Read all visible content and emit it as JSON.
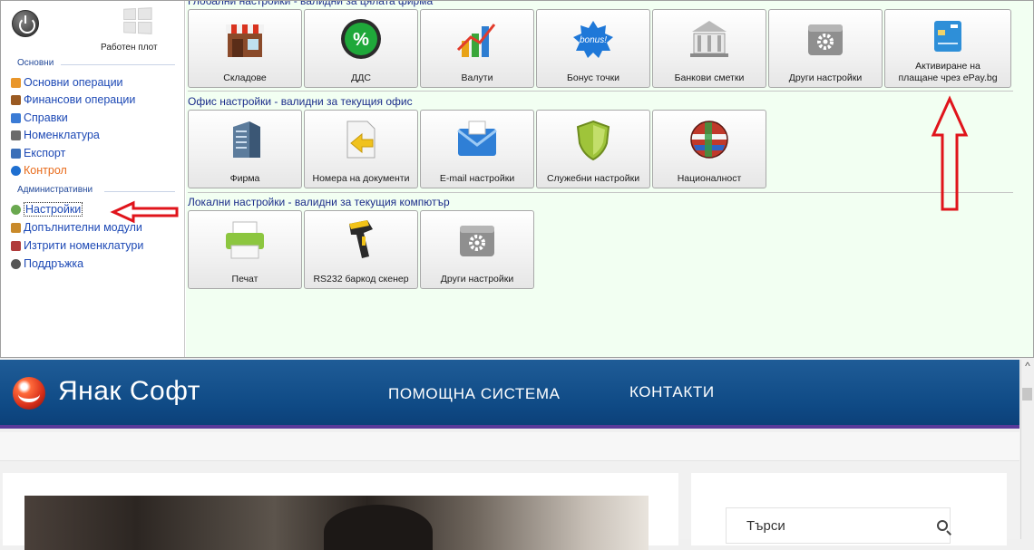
{
  "sidebar": {
    "desktop_label": "Работен плот",
    "groups": {
      "basic_title": "Основни",
      "admin_title": "Административни"
    },
    "basic_items": [
      {
        "label": "Основни операции",
        "icon": "clipboard-icon",
        "color": "#e9962a"
      },
      {
        "label": "Финансови операции",
        "icon": "money-icon",
        "color": "#9a5a22"
      },
      {
        "label": "Справки",
        "icon": "people-report-icon",
        "color": "#3a7bd5"
      },
      {
        "label": "Номенклатура",
        "icon": "person-list-icon",
        "color": "#6b6b6b"
      },
      {
        "label": "Експорт",
        "icon": "export-icon",
        "color": "#3b6fb8"
      },
      {
        "label": "Контрол",
        "icon": "info-icon",
        "color": "#1e6fd0"
      }
    ],
    "admin_items": [
      {
        "label": "Настройки",
        "icon": "settings-icon",
        "color": "#6aa84f"
      },
      {
        "label": "Допълнителни модули",
        "icon": "modules-icon",
        "color": "#c98a2a"
      },
      {
        "label": "Изтрити номенклатури",
        "icon": "deleted-users-icon",
        "color": "#b03a3a"
      },
      {
        "label": "Поддръжка",
        "icon": "support-icon",
        "color": "#555555"
      }
    ]
  },
  "sections": {
    "global_title": "Глобални настройки - валидни за цялата фирма",
    "office_title": "Офис настройки - валидни за текущия офис",
    "local_title": "Локални настройки - валидни за текущия компютър"
  },
  "tiles": {
    "global": [
      {
        "label": "Складове",
        "icon": "store-icon"
      },
      {
        "label": "ДДС",
        "icon": "vat-percent-icon"
      },
      {
        "label": "Валути",
        "icon": "currency-chart-icon"
      },
      {
        "label": "Бонус точки",
        "icon": "bonus-icon"
      },
      {
        "label": "Банкови сметки",
        "icon": "bank-icon"
      },
      {
        "label": "Други настройки",
        "icon": "gear-box-icon"
      },
      {
        "label": "Активиране на плащане чрез ePay.bg",
        "icon": "credit-card-icon"
      }
    ],
    "office": [
      {
        "label": "Фирма",
        "icon": "building-icon"
      },
      {
        "label": "Номера на документи",
        "icon": "document-icon"
      },
      {
        "label": "E-mail настройки",
        "icon": "email-icon"
      },
      {
        "label": "Служебни настройки",
        "icon": "shield-icon"
      },
      {
        "label": "Националност",
        "icon": "globe-flags-icon"
      }
    ],
    "local": [
      {
        "label": "Печат",
        "icon": "printer-icon"
      },
      {
        "label": "RS232 баркод скенер",
        "icon": "barcode-scanner-icon"
      },
      {
        "label": "Други настройки",
        "icon": "gear-box-icon"
      }
    ]
  },
  "website": {
    "brand": "Янак Софт",
    "nav": [
      "ПОМОЩНА СИСТЕМА",
      "КОНТАКТИ"
    ],
    "search_placeholder": "Търси"
  },
  "colors": {
    "accent_red": "#e0141b",
    "header_blue": "#0f4a85",
    "main_bg": "#f2fff2"
  }
}
